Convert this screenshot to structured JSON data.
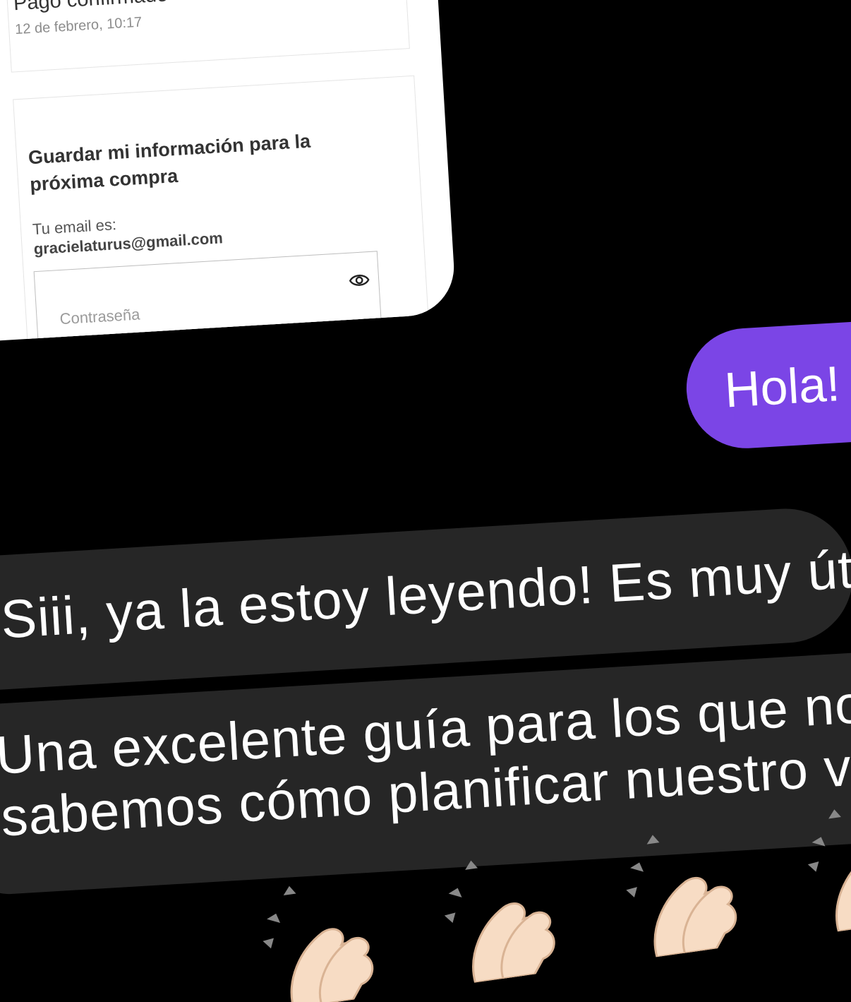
{
  "receipt": {
    "payment_status": "Pago confirmado",
    "payment_date": "12 de febrero, 10:17",
    "save_info_title": "Guardar mi información para la próxima compra",
    "email_label": "Tu email es:",
    "email_value": "gracielaturus@gmail.com",
    "password_placeholder": "Contraseña",
    "password_toggle_icon": "eye-icon"
  },
  "chat": {
    "outgoing": {
      "text": "Hola!",
      "color": "#7b45e6"
    },
    "incoming": [
      {
        "lines": [
          "Siii, ya la estoy leyendo! Es muy útil!"
        ]
      },
      {
        "lines": [
          "Una excelente guía para los que no",
          "sabemos cómo planificar nuestro viaje"
        ]
      }
    ],
    "incoming_color": "#262626",
    "reaction_icons": [
      "clapping-hands-icon",
      "clapping-hands-icon",
      "clapping-hands-icon",
      "clapping-hands-icon"
    ]
  }
}
